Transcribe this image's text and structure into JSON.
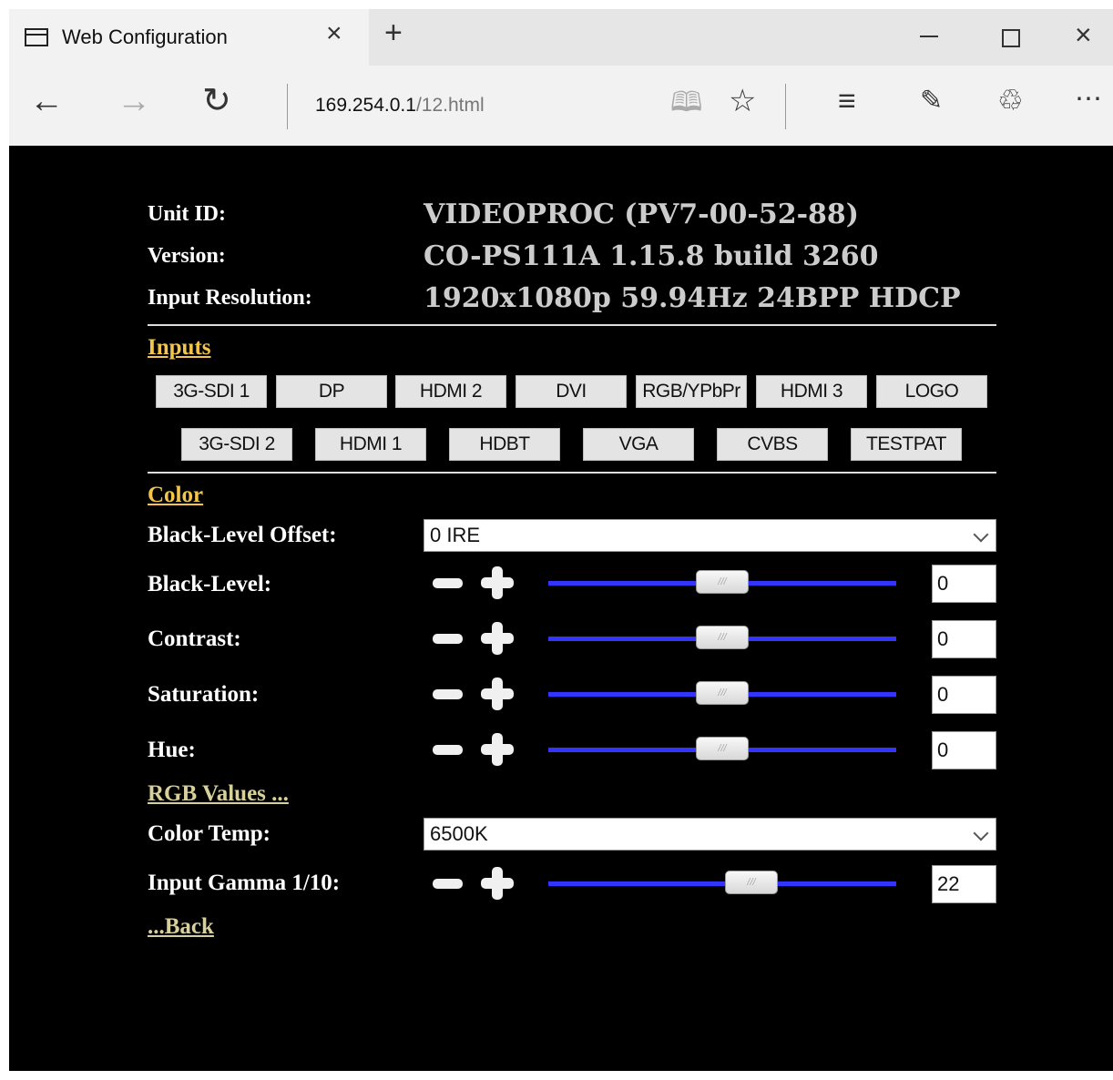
{
  "browser": {
    "tab_title": "Web Configuration",
    "url_host": "169.254.0.1",
    "url_path": "/12.html"
  },
  "info": {
    "unit_id_label": "Unit ID:",
    "unit_id_value": "VIDEOPROC (PV7-00-52-88)",
    "version_label": "Version:",
    "version_value": "CO-PS111A 1.15.8 build 3260",
    "input_res_label": "Input Resolution:",
    "input_res_value": "1920x1080p 59.94Hz 24BPP HDCP"
  },
  "inputs": {
    "heading": "Inputs",
    "row1": [
      "3G-SDI 1",
      "DP",
      "HDMI 2",
      "DVI",
      "RGB/YPbPr",
      "HDMI 3",
      "LOGO"
    ],
    "row2": [
      "3G-SDI 2",
      "HDMI 1",
      "HDBT",
      "VGA",
      "CVBS",
      "TESTPAT"
    ]
  },
  "color": {
    "heading": "Color",
    "black_level_offset_label": "Black-Level Offset:",
    "black_level_offset_value": "0 IRE",
    "black_level_label": "Black-Level:",
    "black_level_value": "0",
    "contrast_label": "Contrast:",
    "contrast_value": "0",
    "saturation_label": "Saturation:",
    "saturation_value": "0",
    "hue_label": "Hue:",
    "hue_value": "0",
    "rgb_values_link": "RGB Values ...",
    "color_temp_label": "Color Temp:",
    "color_temp_value": "6500K",
    "input_gamma_label": "Input Gamma 1/10:",
    "input_gamma_value": "22",
    "back_link": "...Back"
  },
  "sliders": {
    "black_level_level": 0.5,
    "contrast_level": 0.5,
    "saturation_level": 0.5,
    "hue_level": 0.5,
    "input_gamma_level": 0.6
  },
  "colors": {
    "page_bg": "#000000",
    "slider_track": "#3434ff",
    "inputs_heading": "#f3c54a",
    "link_khaki": "#d8d09a"
  }
}
